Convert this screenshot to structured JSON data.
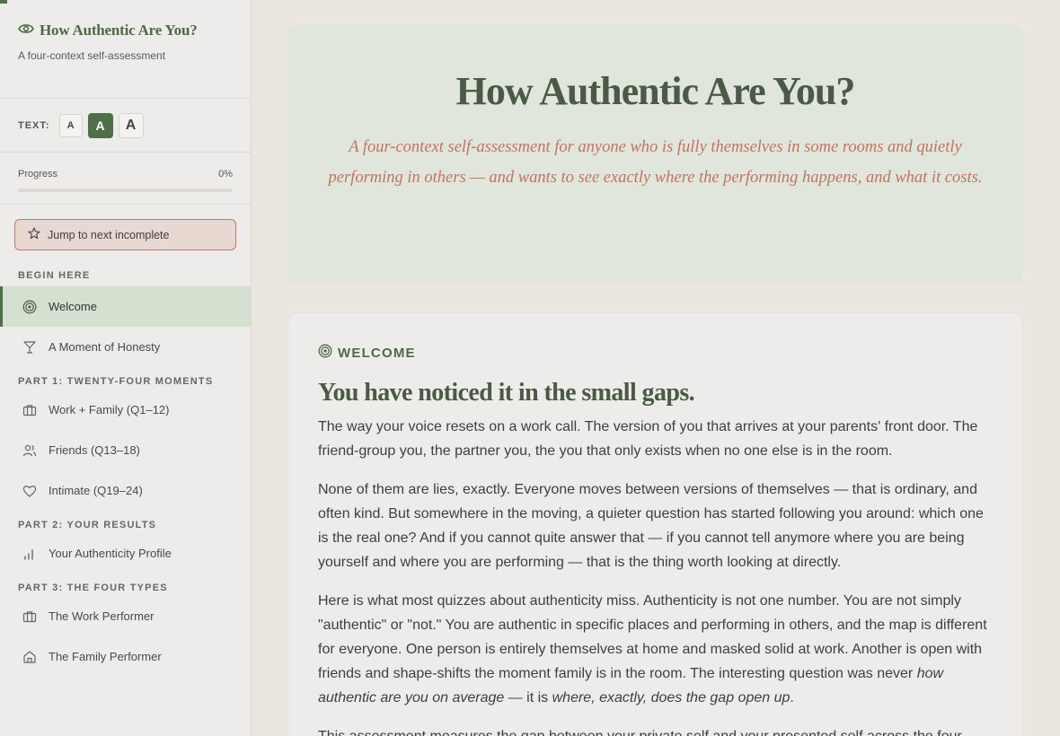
{
  "sidebar": {
    "brand_title": "How Authentic Are You?",
    "brand_subtitle": "A four-context self-assessment",
    "text_label": "TEXT:",
    "text_sizes": [
      "A",
      "A",
      "A"
    ],
    "progress_label": "Progress",
    "progress_value": "0%",
    "progress_fraction": 0,
    "jump_label": "Jump to next incomplete",
    "sections": [
      {
        "title": "BEGIN HERE",
        "items": [
          {
            "label": "Welcome",
            "icon": "target-icon",
            "active": true
          },
          {
            "label": "A Moment of Honesty",
            "icon": "cocktail-icon",
            "active": false
          }
        ]
      },
      {
        "title": "PART 1: TWENTY-FOUR MOMENTS",
        "items": [
          {
            "label": "Work + Family (Q1–12)",
            "icon": "briefcase-icon",
            "active": false
          },
          {
            "label": "Friends (Q13–18)",
            "icon": "users-icon",
            "active": false
          },
          {
            "label": "Intimate (Q19–24)",
            "icon": "heart-icon",
            "active": false
          }
        ]
      },
      {
        "title": "PART 2: YOUR RESULTS",
        "items": [
          {
            "label": "Your Authenticity Profile",
            "icon": "bar-chart-icon",
            "active": false
          }
        ]
      },
      {
        "title": "PART 3: THE FOUR TYPES",
        "items": [
          {
            "label": "The Work Performer",
            "icon": "briefcase-icon",
            "active": false
          },
          {
            "label": "The Family Performer",
            "icon": "home-icon",
            "active": false
          }
        ]
      }
    ]
  },
  "hero": {
    "title": "How Authentic Are You?",
    "subtitle": "A four-context self-assessment for anyone who is fully themselves in some rooms and quietly performing in others — and wants to see exactly where the performing happens, and what it costs."
  },
  "card": {
    "label": "WELCOME",
    "heading": "You have noticed it in the small gaps.",
    "p1": "The way your voice resets on a work call. The version of you that arrives at your parents' front door. The friend-group you, the partner you, the you that only exists when no one else is in the room.",
    "p2": "None of them are lies, exactly. Everyone moves between versions of themselves — that is ordinary, and often kind. But somewhere in the moving, a quieter question has started following you around: which one is the real one? And if you cannot quite answer that — if you cannot tell anymore where you are being yourself and where you are performing — that is the thing worth looking at directly.",
    "p3_a": "Here is what most quizzes about authenticity miss. Authenticity is not one number. You are not simply \"authentic\" or \"not.\" You are authentic in specific places and performing in others, and the map is different for everyone. One person is entirely themselves at home and masked solid at work. Another is open with friends and shape-shifts the moment family is in the room. The interesting question was never ",
    "p3_b": "how authentic are you on average",
    "p3_c": " — it is ",
    "p3_d": "where, exactly, does the gap open up",
    "p3_e": ".",
    "p4": "This assessment measures the gap between your private self and your presented self across the four"
  }
}
